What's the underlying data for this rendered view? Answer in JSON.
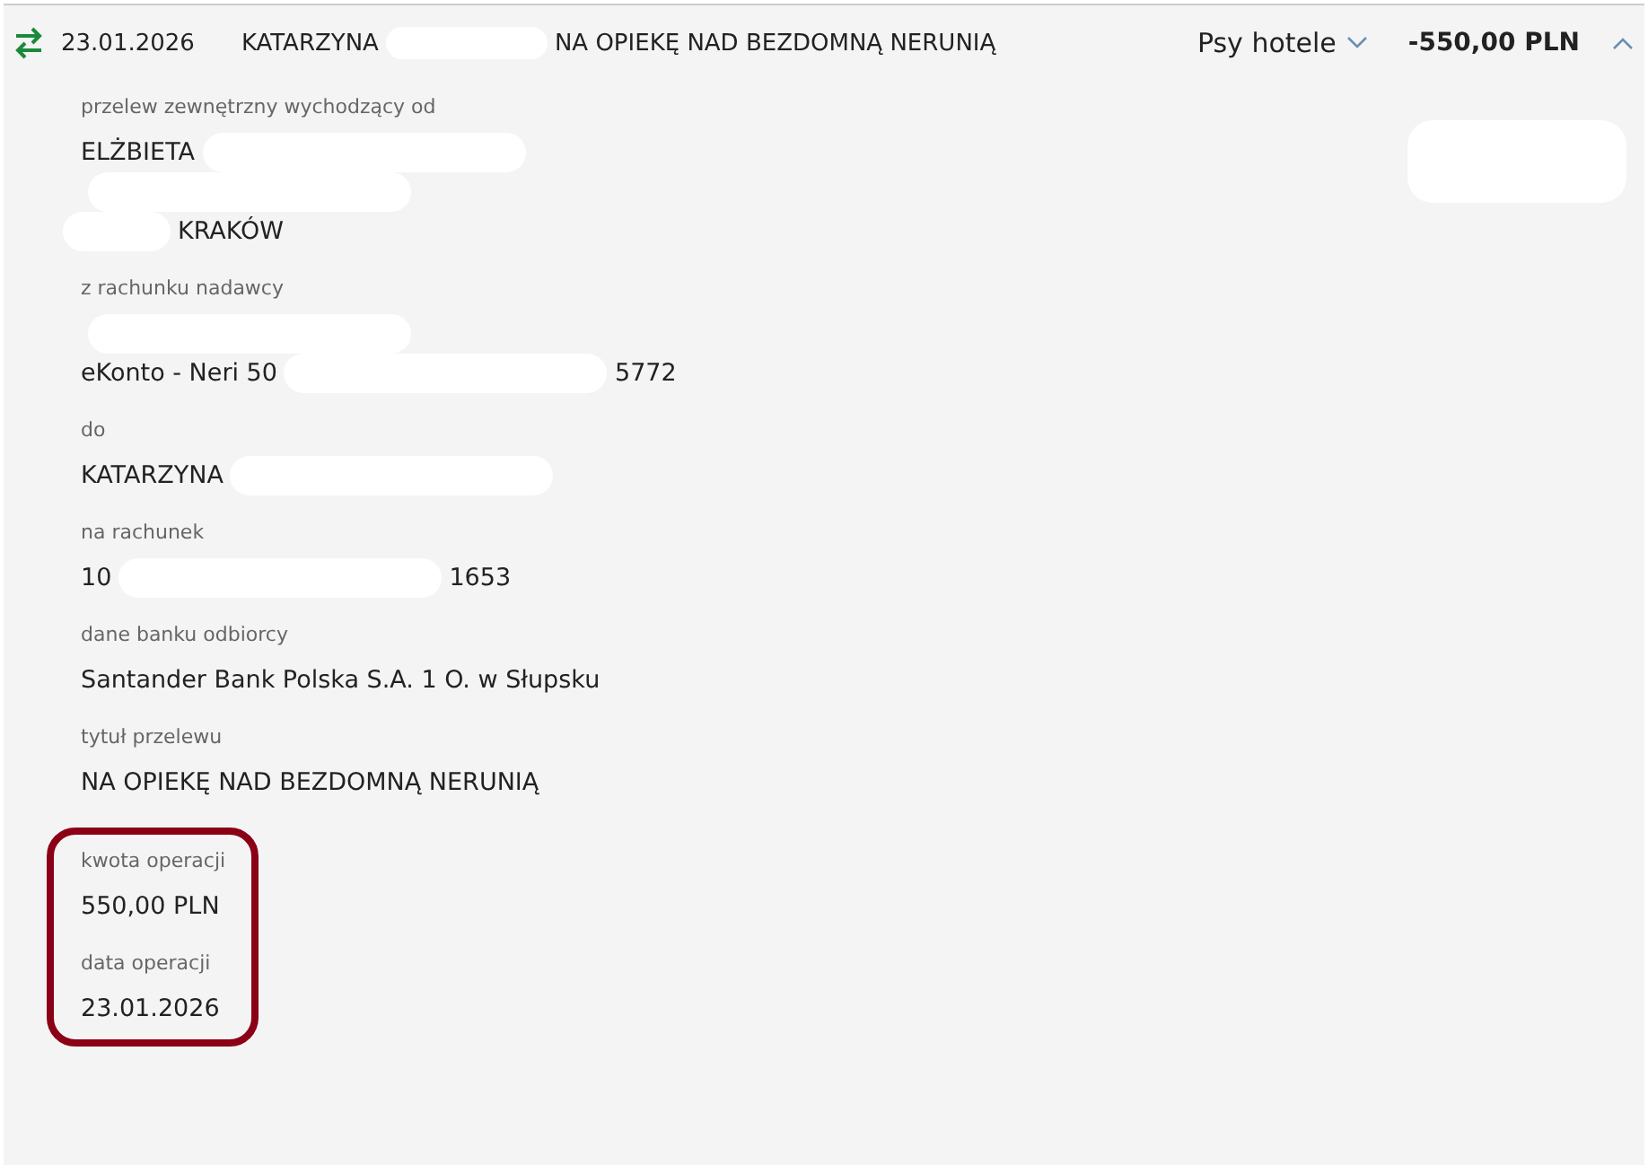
{
  "header": {
    "date": "23.01.2026",
    "title_start": "KATARZYNA",
    "title_redacted": true,
    "title_end": "NA OPIEKĘ NAD BEZDOMNĄ NERUNIĄ",
    "category": "Psy hotele",
    "amount": "-550,00 PLN",
    "expanded": true
  },
  "details": [
    {
      "label": "przelew zewnętrzny wychodzący od",
      "lines": [
        {
          "before": "ELŻBIETA",
          "redacted": true
        },
        {
          "redacted": true
        },
        {
          "redacted": true,
          "after": "KRAKÓW"
        }
      ]
    },
    {
      "label": "z rachunku nadawcy",
      "lines": [
        {
          "redacted": true
        },
        {
          "before": "eKonto - Neri 50",
          "redacted": true,
          "after": "5772"
        }
      ]
    },
    {
      "label": "do",
      "lines": [
        {
          "before": "KATARZYNA",
          "redacted": true
        }
      ]
    },
    {
      "label": "na rachunek",
      "lines": [
        {
          "before": "10",
          "redacted": true,
          "after": "1653"
        }
      ]
    },
    {
      "label": "dane banku odbiorcy",
      "lines": [
        {
          "before": "Santander Bank Polska S.A. 1 O. w Słupsku",
          "redacted": false
        }
      ]
    },
    {
      "label": "tytuł przelewu",
      "lines": [
        {
          "before": "NA OPIEKĘ NAD BEZDOMNĄ NERUNIĄ",
          "redacted": false
        }
      ]
    }
  ],
  "highlighted": [
    {
      "label": "kwota operacji",
      "lines": [
        {
          "before": "550,00 PLN",
          "redacted": false
        }
      ]
    },
    {
      "label": "data operacji",
      "lines": [
        {
          "before": "23.01.2026",
          "redacted": false
        }
      ]
    }
  ]
}
